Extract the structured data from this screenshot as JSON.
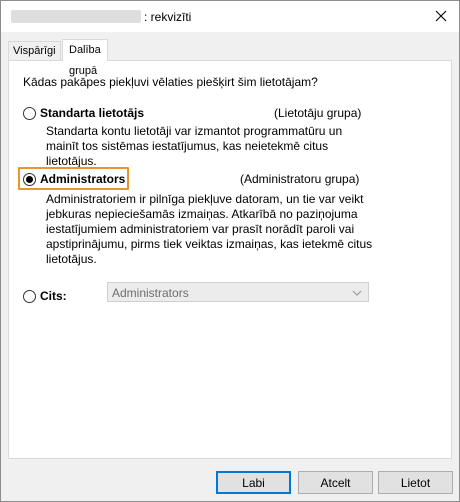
{
  "window": {
    "title_suffix": ": rekvizīti"
  },
  "tabs": [
    {
      "label": "Vispārīgi"
    },
    {
      "label": "Dalība grupā"
    }
  ],
  "panel": {
    "question": "Kādas pakāpes piekļuvi vēlaties piešķirt šim lietotājam?",
    "options": [
      {
        "label": "Standarta lietotājs",
        "group": "(Lietotāju grupa)",
        "description": "Standarta kontu lietotāji var izmantot programmatūru un mainīt tos sistēmas iestatījumus, kas neietekmē citus lietotājus.",
        "checked": false
      },
      {
        "label": "Administrators",
        "group": "(Administratoru grupa)",
        "description": "Administratoriem ir pilnīga piekļuve datoram, un tie var veikt jebkuras nepieciešamās izmaiņas. Atkarībā no paziņojuma iestatījumiem administratoriem var prasīt norādīt paroli vai apstiprinājumu, pirms tiek veiktas izmaiņas, kas ietekmē citus lietotājus.",
        "checked": true
      },
      {
        "label": "Cits:",
        "select_value": "Administrators",
        "checked": false
      }
    ]
  },
  "buttons": {
    "ok": "Labi",
    "cancel": "Atcelt",
    "apply": "Lietot"
  },
  "colors": {
    "focus": "#e8962a",
    "default_button_border": "#0078d7"
  }
}
